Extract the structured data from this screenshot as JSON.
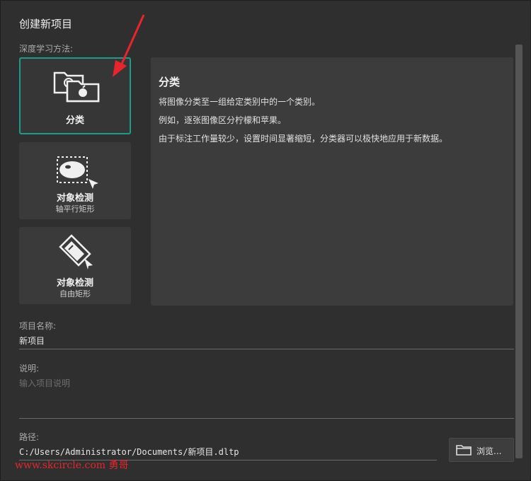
{
  "dialog": {
    "title": "创建新项目",
    "methods_label": "深度学习方法:"
  },
  "methods": [
    {
      "label": "分类",
      "sublabel": "",
      "icon": "classification-folders-icon",
      "selected": true
    },
    {
      "label": "对象检测",
      "sublabel": "轴平行矩形",
      "icon": "lemon-selection-icon",
      "selected": false
    },
    {
      "label": "对象检测",
      "sublabel": "自由矩形",
      "icon": "rotated-box-icon",
      "selected": false
    }
  ],
  "description": {
    "title": "分类",
    "lines": [
      "将图像分类至一组给定类别中的一个类别。",
      "例如，逐张图像区分柠檬和苹果。",
      "由于标注工作量较少，设置时间显著缩短，分类器可以极快地应用于新数据。"
    ]
  },
  "project_name": {
    "label": "项目名称:",
    "value": "新项目"
  },
  "description_field": {
    "label": "说明:",
    "placeholder": "输入项目说明"
  },
  "path": {
    "label": "路径:",
    "value": "C:/Users/Administrator/Documents/新项目.dltp"
  },
  "browse": {
    "label": "浏览...",
    "icon": "folder-icon"
  },
  "watermark": "www.skcircle.com 勇哥",
  "colors": {
    "accent": "#1f9b8a",
    "annotation_arrow": "#e8262a",
    "background": "#2f2f2f"
  }
}
